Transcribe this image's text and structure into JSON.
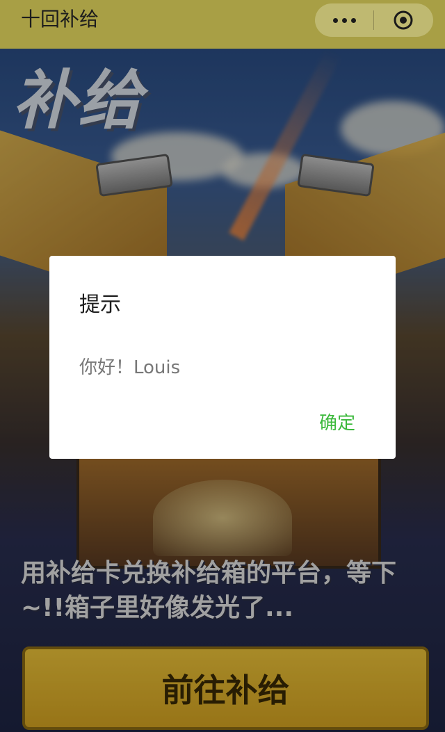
{
  "topbar": {
    "title": "十回补给",
    "menu_icon": "more-dots-icon",
    "close_icon": "target-close-icon"
  },
  "background": {
    "supply_title": "补给",
    "description": "用补给卡兑换补给箱的平台，等下~!!箱子里好像发光了...",
    "go_button_label": "前往补给"
  },
  "modal": {
    "title": "提示",
    "content": "你好！Louis",
    "confirm_label": "确定"
  },
  "colors": {
    "topbar_bg": "#a89f45",
    "confirm_green": "#3cb93c",
    "button_gold": "#e6b52c"
  }
}
